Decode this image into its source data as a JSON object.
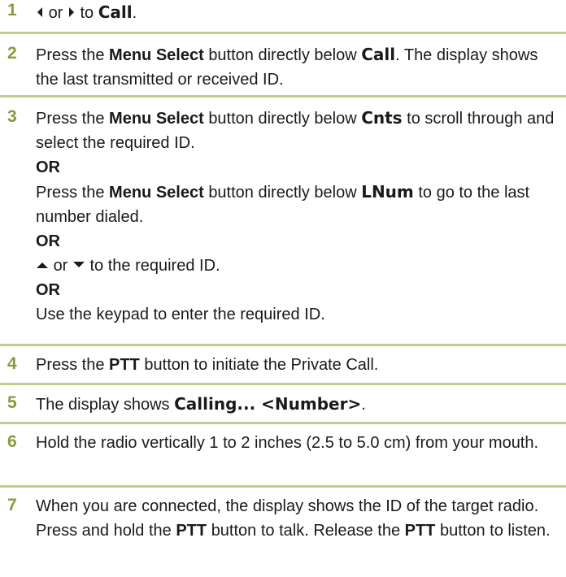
{
  "steps": [
    {
      "number": "1",
      "lines": [
        {
          "left_icon": "triangle-left-icon",
          "or": "or",
          "right_icon": "triangle-right-icon",
          "to": "to",
          "display_text": "Call",
          "period": "."
        }
      ]
    },
    {
      "number": "2",
      "part1": "Press the",
      "button": "Menu Select",
      "part2": "button directly below",
      "display_text": "Call",
      "part3": ". The display shows the last transmitted or received ID."
    },
    {
      "number": "3",
      "a_part1": "Press the",
      "a_button": "Menu Select",
      "a_part2": "button directly below",
      "a_display": "Cnts",
      "a_part3": "to scroll through and select the required ID.",
      "or1": "OR",
      "b_part1": "Press the",
      "b_button": "Menu Select",
      "b_part2": "button directly below",
      "b_display": "LNum",
      "b_part3": "to go to the last number dialed.",
      "or2": "OR",
      "c_up_icon": "up-arrow-icon",
      "c_or": "or",
      "c_down_icon": "down-arrow-icon",
      "c_text": "to the required ID.",
      "or3": "OR",
      "d_text": "Use the keypad to enter the required ID."
    },
    {
      "number": "4",
      "part1": "Press the",
      "button": "PTT",
      "part2": "button to initiate the Private Call."
    },
    {
      "number": "5",
      "part1": "The display shows",
      "display_text": "Calling... <Number>",
      "part2": "."
    },
    {
      "number": "6",
      "text": "Hold the radio vertically 1 to 2 inches (2.5 to 5.0 cm) from your mouth."
    },
    {
      "number": "7",
      "part1": "When you are connected, the display shows the ID of the target radio. Press and hold the",
      "button1": "PTT",
      "part2": "button to talk. Release the",
      "button2": "PTT",
      "part3": "button to listen."
    }
  ],
  "colors": {
    "step_number": "#8a9a3a",
    "divider": "#c9c98f",
    "text": "#1a1a1a"
  }
}
